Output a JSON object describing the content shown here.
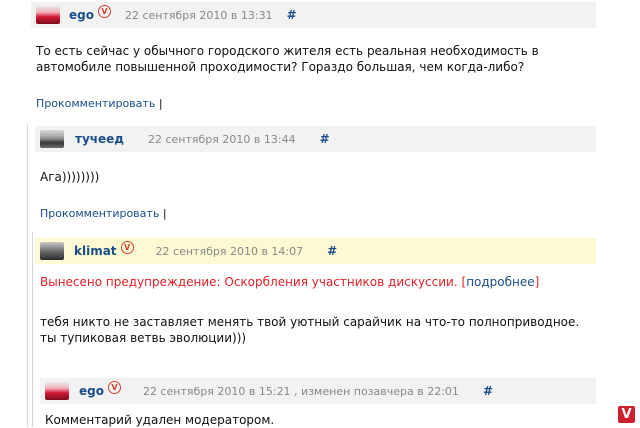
{
  "comments": [
    {
      "author": "ego",
      "date": "22 сентября 2010 в 13:31",
      "hash": "#",
      "text": "То есть сейчас у обычного городского жителя есть реальная необходимость в автомобиле повышенной проходимости? Гораздо большая, чем когда-либо?",
      "reply_label": "Прокомментировать",
      "reply_sep": "|"
    },
    {
      "author": "тучеед",
      "date": "22 сентября 2010 в 13:44",
      "hash": "#",
      "text": "Ага))))))))",
      "reply_label": "Прокомментировать",
      "reply_sep": "|"
    },
    {
      "author": "klimat",
      "date": "22 сентября 2010 в 14:07",
      "hash": "#",
      "warning": "Вынесено предупреждение: Оскорбления участников дискуссии.",
      "warning_open": "[",
      "warning_more": "подробнее",
      "warning_close": "]",
      "text": "тебя никто не заставляет менять твой уютный сарайчик на что-то полноприводное. ты тупиковая ветвь эволюции)))"
    },
    {
      "author": "ego",
      "date": "22 сентября 2010 в 15:21 , изменен позавчера в 22:01",
      "hash": "#",
      "text": "Комментарий удален модератором."
    }
  ],
  "badge_glyph": "V",
  "corner_logo": "V",
  "colors": {
    "header_bg": "#f2f2f2",
    "highlight_bg": "#fdf9d2",
    "link": "#1a4d8a",
    "warning": "#e3202a"
  }
}
